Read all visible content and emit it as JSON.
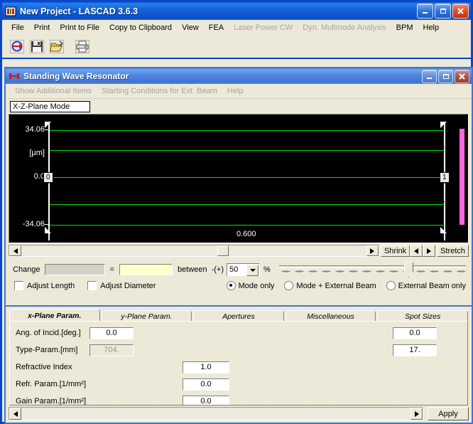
{
  "app": {
    "title": "New Project - LASCAD 3.6.3",
    "menu": [
      {
        "label": "File",
        "disabled": false
      },
      {
        "label": "Print",
        "disabled": false
      },
      {
        "label": "Print to File",
        "disabled": false
      },
      {
        "label": "Copy to Clipboard",
        "disabled": false
      },
      {
        "label": "View",
        "disabled": false
      },
      {
        "label": "FEA",
        "disabled": false
      },
      {
        "label": "Laser Power CW",
        "disabled": true
      },
      {
        "label": "Dyn. Multmode Analysis",
        "disabled": true
      },
      {
        "label": "BPM",
        "disabled": false
      },
      {
        "label": "Help",
        "disabled": false
      }
    ],
    "toolbar": [
      {
        "name": "refresh-icon"
      },
      {
        "name": "save-icon"
      },
      {
        "name": "open-folder-icon"
      },
      {
        "name": "print-icon"
      }
    ],
    "window_buttons": {
      "minimize": "_",
      "maximize": "□",
      "close": "✕"
    }
  },
  "inner": {
    "title": "Standing Wave Resonator",
    "menu": [
      {
        "label": "Show Additional Items",
        "disabled": true
      },
      {
        "label": "Starting Conditions for Ext. Beam",
        "disabled": true
      },
      {
        "label": "Help",
        "disabled": true
      }
    ],
    "mode_field": "X-Z-Plane Mode"
  },
  "chart_data": {
    "type": "line",
    "title": "",
    "xlabel": "",
    "ylabel": "[μm]",
    "background": "#000000",
    "line_color": "#00e000",
    "secondary_line_color": "#3a0018",
    "marker_color": "#ff66dd",
    "y_ticks": [
      "34.06",
      "0.0",
      "-34.06"
    ],
    "ylim": [
      -34.06,
      34.06
    ],
    "x_ticks": [
      "0.600"
    ],
    "xlim": [
      0,
      0.6
    ],
    "node_labels": [
      "0",
      "1"
    ],
    "series": [
      {
        "name": "mode-envelope-upper",
        "y": 34.06
      },
      {
        "name": "mode-envelope-upper-inner",
        "y": 22.5
      },
      {
        "name": "optical-axis",
        "y": 0.0
      },
      {
        "name": "mode-envelope-lower-inner",
        "y": -22.0
      },
      {
        "name": "mode-envelope-lower",
        "y": -34.06
      }
    ]
  },
  "plot_controls": {
    "shrink_label": "Shrink",
    "stretch_label": "Stretch",
    "left_arrow": "◄",
    "right_arrow": "►"
  },
  "change_row": {
    "label": "Change",
    "element_value": "",
    "equals": "=",
    "value": "",
    "between_label": "between",
    "pm_label": "-(+)",
    "percent_value": "50",
    "percent_sign": "%"
  },
  "checkboxes": [
    {
      "label": "Adjust Length",
      "checked": false
    },
    {
      "label": "Adjust Diameter",
      "checked": false
    }
  ],
  "radios": [
    {
      "label": "Mode only",
      "checked": true
    },
    {
      "label": "Mode + External Beam",
      "checked": false
    },
    {
      "label": "External Beam only",
      "checked": false
    }
  ],
  "tabs": [
    {
      "label": "x-Plane Param.",
      "active": true
    },
    {
      "label": "y-Plane Param.",
      "active": false
    },
    {
      "label": "Apertures",
      "active": false
    },
    {
      "label": "Miscellaneous",
      "active": false
    },
    {
      "label": "Spot Sizes",
      "active": false
    }
  ],
  "form": {
    "rows": [
      {
        "label": "Ang. of Incid.[deg.]",
        "value": "0.0",
        "disabled": false,
        "right_value": "0.0"
      },
      {
        "label": "Type-Param.[mm]",
        "value": "704.",
        "disabled": true,
        "right_value": "17."
      },
      {
        "label": "Refractive Index",
        "mid_value": "1.0"
      },
      {
        "label": "Refr. Param.[1/mm²]",
        "mid_value": "0.0"
      },
      {
        "label": "Gain Param.[1/mm²]",
        "mid_value": "0.0"
      }
    ]
  },
  "apply_label": "Apply"
}
